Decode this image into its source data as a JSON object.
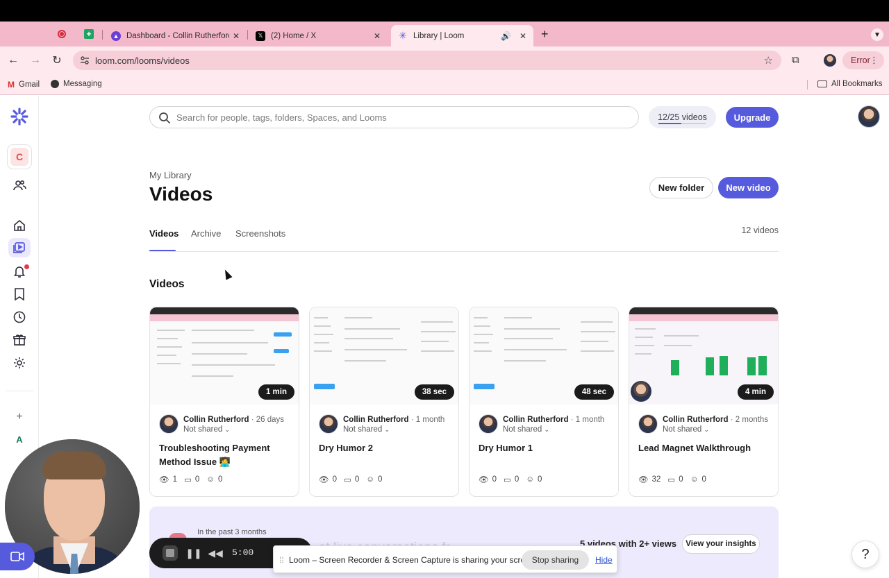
{
  "browser": {
    "tabs": [
      {
        "title": "Dashboard - Collin Rutherford",
        "favicon": "dashboard-favicon"
      },
      {
        "title": "(2) Home / X",
        "favicon": "x-favicon"
      },
      {
        "title": "Library | Loom",
        "favicon": "loom-favicon",
        "active": true
      }
    ],
    "url": "loom.com/looms/videos",
    "error_label": "Error",
    "bookmarks": [
      "Gmail",
      "Messaging"
    ],
    "all_bookmarks": "All Bookmarks"
  },
  "sidebar": {
    "workspace_initial": "C",
    "bottom_initial": "A"
  },
  "header": {
    "search_placeholder": "Search for people, tags, folders, Spaces, and Looms",
    "quota_label": "12/25 videos",
    "quota_fraction": 0.48,
    "upgrade_label": "Upgrade"
  },
  "page": {
    "breadcrumb": "My Library",
    "title": "Videos",
    "new_folder_label": "New folder",
    "new_video_label": "New video",
    "tabs": [
      "Videos",
      "Archive",
      "Screenshots"
    ],
    "video_count": "12 videos",
    "section_heading": "Videos"
  },
  "videos": [
    {
      "duration": "1 min",
      "author": "Collin Rutherford",
      "age": "· 26 days",
      "sharing": "Not shared",
      "title": "Troubleshooting Payment Method Issue 🧑‍💻",
      "views": "1",
      "comments": "0",
      "reactions": "0"
    },
    {
      "duration": "38 sec",
      "author": "Collin Rutherford",
      "age": "· 1 month",
      "sharing": "Not shared",
      "title": "Dry Humor 2",
      "views": "0",
      "comments": "0",
      "reactions": "0"
    },
    {
      "duration": "48 sec",
      "author": "Collin Rutherford",
      "age": "· 1 month",
      "sharing": "Not shared",
      "title": "Dry Humor 1",
      "views": "0",
      "comments": "0",
      "reactions": "0"
    },
    {
      "duration": "4 min",
      "author": "Collin Rutherford",
      "age": "· 2 months",
      "sharing": "Not shared",
      "title": "Lead Magnet Walkthrough",
      "views": "32",
      "comments": "0",
      "reactions": "0"
    }
  ],
  "insights": {
    "period": "In the past 3 months",
    "faded_text": "...at live conversations fr...",
    "summary": "5 videos with 2+ views",
    "button_label": "View your insights"
  },
  "recorder": {
    "timer": "5:00"
  },
  "sharing_notice": {
    "text": "Loom – Screen Recorder & Screen Capture is sharing your screen.",
    "stop_label": "Stop sharing",
    "hide_label": "Hide"
  },
  "help_label": "?",
  "colors": {
    "accent": "#565add",
    "tab_strip": "#f3b8c9",
    "chrome_bg": "#fde9ee"
  }
}
